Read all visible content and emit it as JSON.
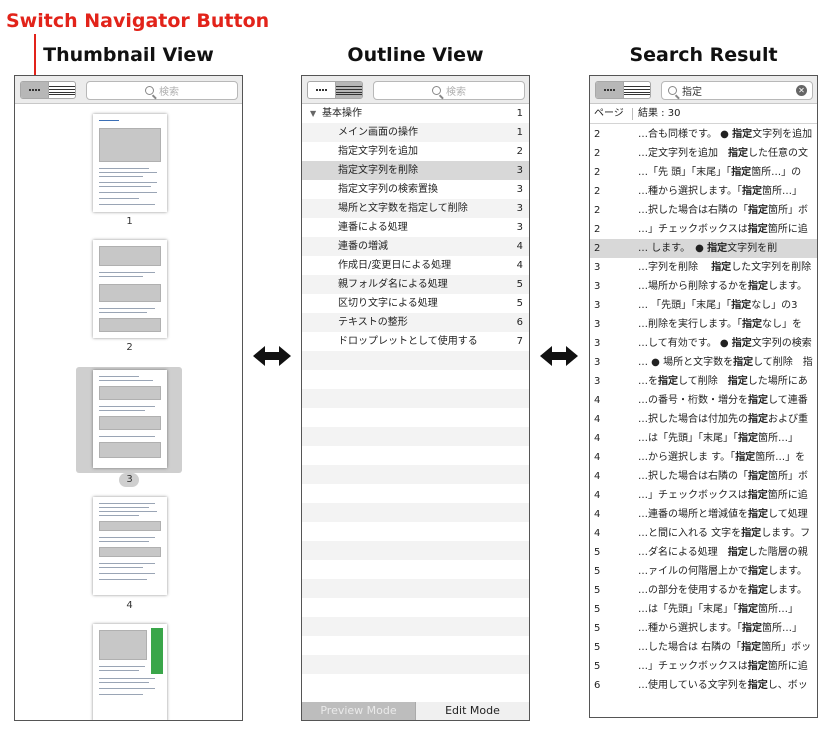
{
  "annotation": {
    "label": "Switch Navigator Button"
  },
  "headings": {
    "thumbnail": "Thumbnail View",
    "outline": "Outline View",
    "search": "Search Result"
  },
  "search_placeholder": "検索",
  "search_query": "指定",
  "thumbnails": {
    "pages": [
      "1",
      "2",
      "3",
      "4"
    ],
    "selected": "3"
  },
  "outline": {
    "rows": [
      {
        "title": "基本操作",
        "page": "1",
        "top": true
      },
      {
        "title": "メイン画面の操作",
        "page": "1"
      },
      {
        "title": "指定文字列を追加",
        "page": "2"
      },
      {
        "title": "指定文字列を削除",
        "page": "3",
        "selected": true
      },
      {
        "title": "指定文字列の検索置換",
        "page": "3"
      },
      {
        "title": "場所と文字数を指定して削除",
        "page": "3"
      },
      {
        "title": "連番による処理",
        "page": "3"
      },
      {
        "title": "連番の増減",
        "page": "4"
      },
      {
        "title": "作成日/変更日による処理",
        "page": "4"
      },
      {
        "title": "親フォルダ名による処理",
        "page": "5"
      },
      {
        "title": "区切り文字による処理",
        "page": "5"
      },
      {
        "title": "テキストの整形",
        "page": "6"
      },
      {
        "title": "ドロップレットとして使用する",
        "page": "7"
      }
    ],
    "preview_mode": "Preview Mode",
    "edit_mode": "Edit Mode"
  },
  "search_results": {
    "col_page": "ページ",
    "col_result": "結果 : 30",
    "rows": [
      {
        "page": "2",
        "text": "…合も同様です。 ● 指定文字列を追加"
      },
      {
        "page": "2",
        "text": "…定文字列を追加　指定した任意の文"
      },
      {
        "page": "2",
        "text": "…「先 頭」「末尾」「指定箇所…」の"
      },
      {
        "page": "2",
        "text": "…種から選択します。「指定箇所…」"
      },
      {
        "page": "2",
        "text": "…択した場合は右隣の「指定箇所」ボ"
      },
      {
        "page": "2",
        "text": "…」チェックボックスは指定箇所に追"
      },
      {
        "page": "2",
        "text": "… します。　● 指定文字列を削",
        "selected": true
      },
      {
        "page": "3",
        "text": "…字列を削除　 指定した文字列を削除"
      },
      {
        "page": "3",
        "text": "…場所から削除するかを指定します。"
      },
      {
        "page": "3",
        "text": "… 「先頭」「末尾」「指定なし」の3"
      },
      {
        "page": "3",
        "text": "…削除を実行します。「指定なし」を"
      },
      {
        "page": "3",
        "text": "…して有効です。 ● 指定文字列の検索"
      },
      {
        "page": "3",
        "text": "… ● 場所と文字数を指定して削除　指"
      },
      {
        "page": "3",
        "text": "…を指定して削除　指定した場所にあ"
      },
      {
        "page": "4",
        "text": "…の番号・桁数・増分を指定して連番"
      },
      {
        "page": "4",
        "text": "…択した場合は付加先の指定および重"
      },
      {
        "page": "4",
        "text": "…は「先頭」「末尾」「指定箇所…」"
      },
      {
        "page": "4",
        "text": "…から選択しま す。「指定箇所…」を"
      },
      {
        "page": "4",
        "text": "…択した場合は右隣の「指定箇所」ボ"
      },
      {
        "page": "4",
        "text": "…」チェックボックスは指定箇所に追"
      },
      {
        "page": "4",
        "text": "…連番の場所と増減値を指定して処理"
      },
      {
        "page": "4",
        "text": "…と間に入れる 文字を指定します。フ"
      },
      {
        "page": "5",
        "text": "…ダ名による処理　指定した階層の親"
      },
      {
        "page": "5",
        "text": "…ァイルの何階層上かで指定します。"
      },
      {
        "page": "5",
        "text": "…の部分を使用するかを指定します。"
      },
      {
        "page": "5",
        "text": "…は「先頭」「末尾」「指定箇所…」"
      },
      {
        "page": "5",
        "text": "…種から選択します。「指定箇所…」"
      },
      {
        "page": "5",
        "text": "…した場合は 右隣の「指定箇所」ボッ"
      },
      {
        "page": "5",
        "text": "…」チェックボックスは指定箇所に追"
      },
      {
        "page": "6",
        "text": "…使用している文字列を指定し、ボッ"
      }
    ]
  }
}
